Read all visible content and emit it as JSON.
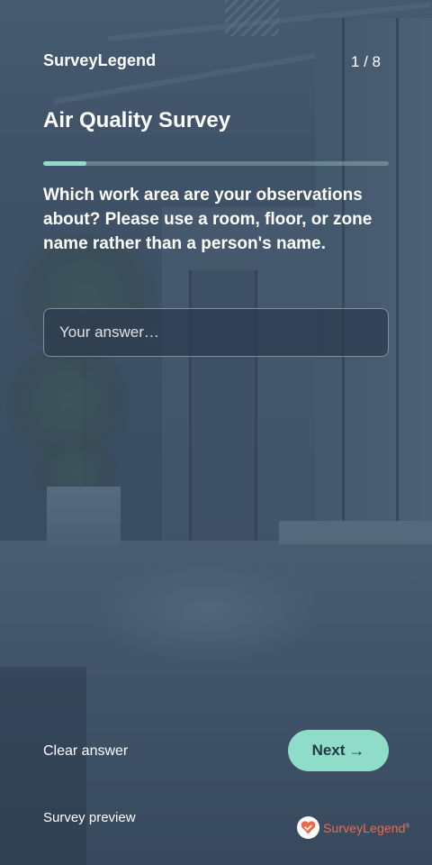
{
  "header": {
    "brand": "SurveyLegend",
    "progress_text": "1 / 8",
    "progress_fraction": 0.125
  },
  "survey": {
    "title": "Air Quality Survey",
    "question": "Which work area are your observations about? Please use a room, floor, or zone name rather than a person's name.",
    "answer": {
      "value": "",
      "placeholder": "Your answer…"
    }
  },
  "actions": {
    "clear_label": "Clear answer",
    "next_label": "Next",
    "next_icon": "arrow-right-icon"
  },
  "footer": {
    "preview_label": "Survey preview",
    "logo_text": "SurveyLegend",
    "logo_mark": "®",
    "logo_icon": "heart-check-icon"
  },
  "colors": {
    "accent": "#8fdcc8",
    "brand_logo": "#ef6a4c",
    "background_tint": "#3e5266"
  }
}
